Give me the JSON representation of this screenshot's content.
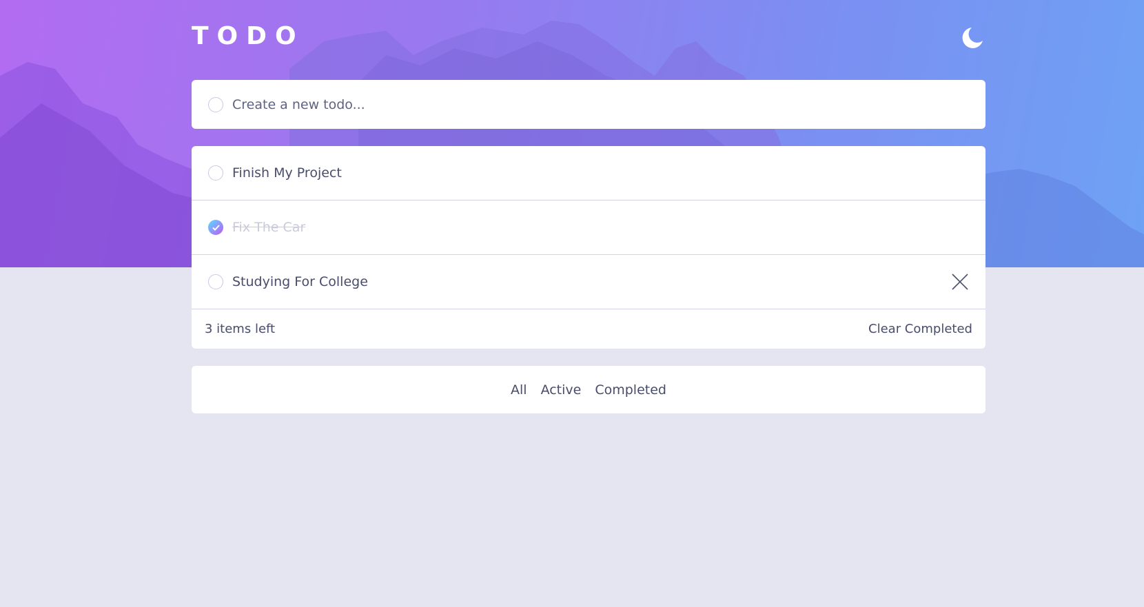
{
  "header": {
    "title": "TODO",
    "theme_icon": "moon-icon"
  },
  "new_todo": {
    "placeholder": "Create a new todo..."
  },
  "todos": [
    {
      "text": "Finish My Project",
      "completed": false
    },
    {
      "text": "Fix The Car",
      "completed": true
    },
    {
      "text": "Studying For College",
      "completed": false
    }
  ],
  "footer": {
    "items_left": "3 items left",
    "clear_label": "Clear Completed"
  },
  "filters": {
    "all": "All",
    "active": "Active",
    "completed": "Completed"
  },
  "colors": {
    "gradient_start": "#b26cf1",
    "gradient_end": "#6ea2f4",
    "background": "#e4e5f1",
    "text": "#494c6b",
    "completed_text": "#c9cadb"
  }
}
